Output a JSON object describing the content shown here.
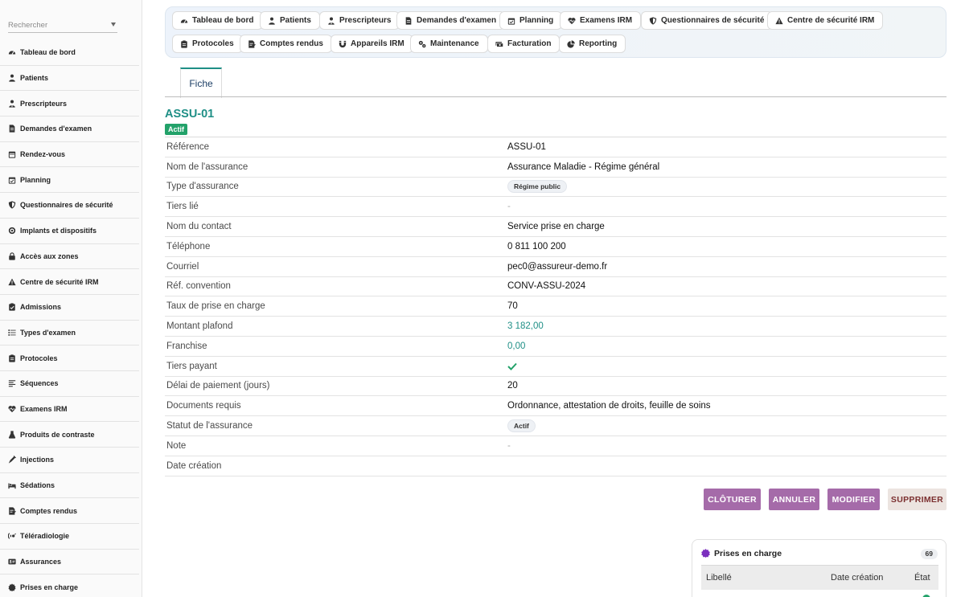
{
  "search": {
    "placeholder": "Rechercher"
  },
  "sidebar": {
    "items": [
      {
        "label": "Tableau de bord",
        "icon": "dashboard-icon"
      },
      {
        "label": "Patients",
        "icon": "user-icon"
      },
      {
        "label": "Prescripteurs",
        "icon": "doctor-icon"
      },
      {
        "label": "Demandes d'examen",
        "icon": "file-icon"
      },
      {
        "label": "Rendez-vous",
        "icon": "calendar-icon"
      },
      {
        "label": "Planning",
        "icon": "calendar-check-icon"
      },
      {
        "label": "Questionnaires de sécurité",
        "icon": "shield-icon"
      },
      {
        "label": "Implants et dispositifs",
        "icon": "implant-icon"
      },
      {
        "label": "Accès aux zones",
        "icon": "lock-icon"
      },
      {
        "label": "Centre de sécurité IRM",
        "icon": "warning-icon"
      },
      {
        "label": "Admissions",
        "icon": "clipboard-icon"
      },
      {
        "label": "Types d'examen",
        "icon": "list-icon"
      },
      {
        "label": "Protocoles",
        "icon": "clipboard-list-icon"
      },
      {
        "label": "Séquences",
        "icon": "lines-icon"
      },
      {
        "label": "Examens IRM",
        "icon": "heart-pulse-icon"
      },
      {
        "label": "Produits de contraste",
        "icon": "flask-icon"
      },
      {
        "label": "Injections",
        "icon": "syringe-icon"
      },
      {
        "label": "Sédations",
        "icon": "bed-icon"
      },
      {
        "label": "Comptes rendus",
        "icon": "report-icon"
      },
      {
        "label": "Téléradiologie",
        "icon": "satellite-icon"
      },
      {
        "label": "Assurances",
        "icon": "id-card-icon"
      },
      {
        "label": "Prises en charge",
        "icon": "badge-icon"
      }
    ]
  },
  "chips": [
    {
      "label": "Tableau de bord",
      "icon": "dashboard-icon"
    },
    {
      "label": "Patients",
      "icon": "user-icon"
    },
    {
      "label": "Prescripteurs",
      "icon": "doctor-icon"
    },
    {
      "label": "Demandes d'examen",
      "icon": "file-icon"
    },
    {
      "label": "Planning",
      "icon": "calendar-check-icon"
    },
    {
      "label": "Examens IRM",
      "icon": "heart-pulse-icon"
    },
    {
      "label": "Questionnaires de sécurité",
      "icon": "shield-icon"
    },
    {
      "label": "Centre de sécurité IRM",
      "icon": "warning-icon"
    },
    {
      "label": "Protocoles",
      "icon": "clipboard-list-icon"
    },
    {
      "label": "Comptes rendus",
      "icon": "report-icon"
    },
    {
      "label": "Appareils IRM",
      "icon": "magnet-icon"
    },
    {
      "label": "Maintenance",
      "icon": "gears-icon"
    },
    {
      "label": "Facturation",
      "icon": "money-icon"
    },
    {
      "label": "Reporting",
      "icon": "chart-pie-icon"
    }
  ],
  "tab": {
    "label": "Fiche"
  },
  "record": {
    "title": "ASSU-01",
    "status_badge": "Actif",
    "fields": [
      {
        "label": "Référence",
        "value": "ASSU-01",
        "kind": "text"
      },
      {
        "label": "Nom de l'assurance",
        "value": "Assurance Maladie - Régime général",
        "kind": "text"
      },
      {
        "label": "Type d'assurance",
        "value": "Régime public",
        "kind": "pill"
      },
      {
        "label": "Tiers lié",
        "value": "-",
        "kind": "dash"
      },
      {
        "label": "Nom du contact",
        "value": "Service prise en charge",
        "kind": "text"
      },
      {
        "label": "Téléphone",
        "value": "0 811 100 200",
        "kind": "text"
      },
      {
        "label": "Courriel",
        "value": "pec0@assureur-demo.fr",
        "kind": "text"
      },
      {
        "label": "Réf. convention",
        "value": "CONV-ASSU-2024",
        "kind": "text"
      },
      {
        "label": "Taux de prise en charge",
        "value": "70",
        "kind": "text"
      },
      {
        "label": "Montant plafond",
        "value": "3 182,00",
        "kind": "num"
      },
      {
        "label": "Franchise",
        "value": "0,00",
        "kind": "num"
      },
      {
        "label": "Tiers payant",
        "value": "",
        "kind": "check"
      },
      {
        "label": "Délai de paiement (jours)",
        "value": "20",
        "kind": "text"
      },
      {
        "label": "Documents requis",
        "value": "Ordonnance, attestation de droits, feuille de soins",
        "kind": "text"
      },
      {
        "label": "Statut de l'assurance",
        "value": "Actif",
        "kind": "pill"
      },
      {
        "label": "Note",
        "value": "-",
        "kind": "dash"
      },
      {
        "label": "Date création",
        "value": "",
        "kind": "text"
      }
    ]
  },
  "actions": {
    "close_label": "CLÔTURER",
    "cancel_label": "ANNULER",
    "edit_label": "MODIFIER",
    "delete_label": "SUPPRIMER"
  },
  "panel": {
    "title": "Prises en charge",
    "count": "69",
    "columns": [
      "Libellé",
      "Date création",
      "État"
    ]
  },
  "colors": {
    "accent": "#1f8f86",
    "action": "#a56ba9",
    "success": "#23a26a",
    "danger_text": "#7b2f2f"
  }
}
